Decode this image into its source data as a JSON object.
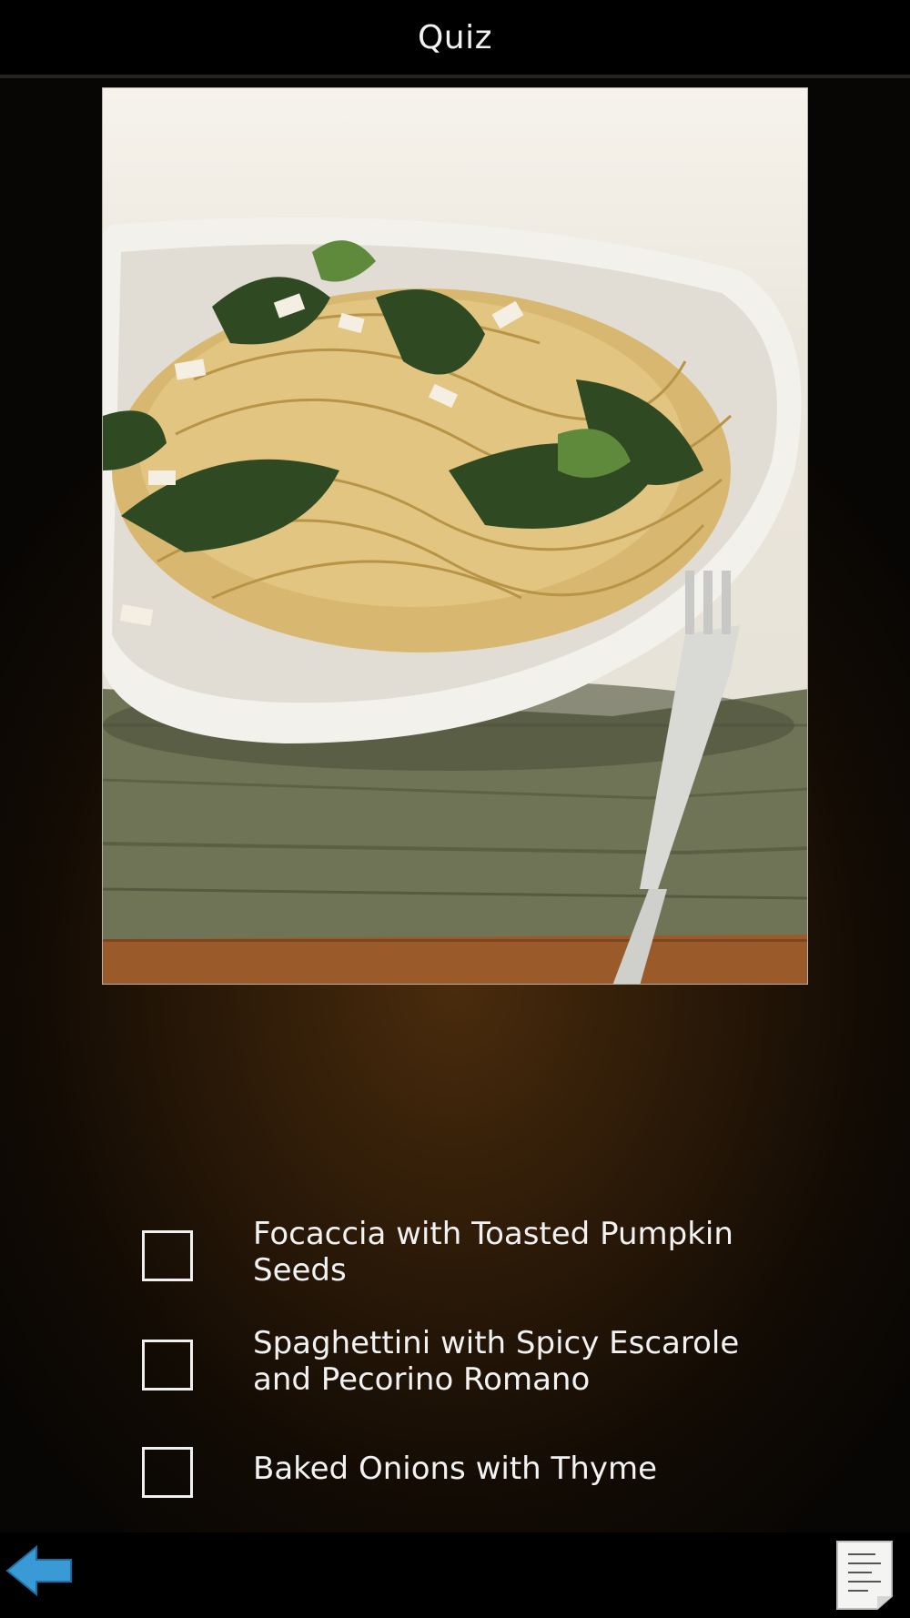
{
  "header": {
    "title": "Quiz"
  },
  "photo": {
    "subject": "pasta-dish-photo"
  },
  "options": [
    {
      "label": "Focaccia with Toasted Pumpkin Seeds",
      "checked": false
    },
    {
      "label": "Spaghettini with Spicy Escarole and Pecorino Romano",
      "checked": false
    },
    {
      "label": "Baked Onions with Thyme",
      "checked": false
    }
  ],
  "toolbar": {
    "back_icon": "back-arrow-icon",
    "notes_icon": "notes-page-icon"
  },
  "colors": {
    "header_bg": "#000000",
    "background_glow": "#4a2c0d",
    "text": "#f2f2f2",
    "back_arrow": "#3a9ad6"
  }
}
